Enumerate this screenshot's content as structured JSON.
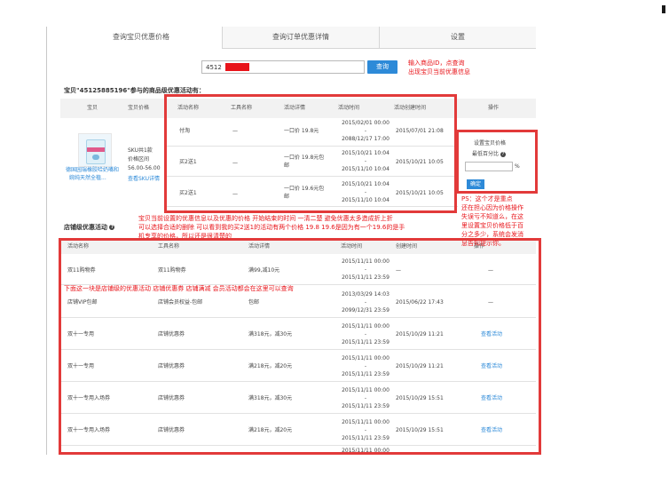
{
  "tabs": [
    "查询宝贝优惠价格",
    "查询订单优惠详情",
    "设置"
  ],
  "search": {
    "value": "4512",
    "button": "查询"
  },
  "annotations": {
    "search_hint": [
      "输入商品ID，点查询",
      "出现宝贝当前优惠信息"
    ],
    "ps_note": [
      "PS：这个才是重点",
      "还在担心因为价格操作",
      "失误亏不知道么，在这",
      "里设置宝贝价格低于百",
      "分之多少，系统会发消",
      "息告知提示你。"
    ],
    "shop_note": [
      "宝贝当前设置的优惠信息以及优惠的价格 开始结束的时间 一清二楚 避免优惠太多造成折上折",
      "可以选择合适的删除 可以看到我的买2送1的活动有两个价格 19.8  19.6是因为有一个19.6的是手",
      "机专享的价格，所以还是很清楚的"
    ],
    "below_note": "下面这一块是店铺级的优惠活动 店铺优惠券  店铺满减 会员活动都会在这里可以查询"
  },
  "item_heading": "宝贝\"45125885196\"参与的商品级优惠活动有：",
  "item_table": {
    "headers": [
      "宝贝",
      "宝贝价格",
      "活动名称",
      "工具名称",
      "活动详情",
      "活动时间",
      "活动创建时间",
      "操作"
    ],
    "product": {
      "name_lines": [
        "德国园瑞橡胶哈奶嘴和",
        "婉纯天然全植..."
      ],
      "price_lines": [
        "SKU共1款",
        "价格区间",
        "56.00-56.00"
      ],
      "sku_link": "查看SKU详情"
    },
    "rows": [
      {
        "name": "付淘",
        "tool": "—",
        "detail": [
          "一口价 19.8元"
        ],
        "time": [
          "2015/02/01 00:00",
          "-",
          "2088/12/17 17:00"
        ],
        "created": "2015/07/01 21:08"
      },
      {
        "name": "买2送1",
        "tool": "—",
        "detail": [
          "一口价 19.8元包",
          "邮"
        ],
        "time": [
          "2015/10/21 10:04",
          "-",
          "2015/11/10 10:04"
        ],
        "created": "2015/10/21 10:05"
      },
      {
        "name": "买2送1",
        "tool": "—",
        "detail": [
          "一口价 19.6元包",
          "邮"
        ],
        "time": [
          "2015/10/21 10:04",
          "-",
          "2015/11/10 10:04"
        ],
        "created": "2015/10/21 10:05"
      }
    ],
    "settings": {
      "title": "设置宝贝价格",
      "label": "最低百分比",
      "help": "?",
      "unit": "%",
      "confirm": "确定"
    }
  },
  "shop_heading": "店铺级优惠活动",
  "shop_table": {
    "headers": [
      "活动名称",
      "工具名称",
      "活动详情",
      "活动时间",
      "创建时间",
      "操作"
    ],
    "rows": [
      {
        "name": "双11购物券",
        "tool": "双11购物券",
        "detail": "满99,减10元",
        "time": [
          "2015/11/11 00:00",
          "-",
          "2015/11/11 23:59"
        ],
        "created": "—",
        "op": "—"
      },
      {
        "name": "店铺VIP包邮",
        "tool": "店铺会员权益-包邮",
        "detail": "包邮",
        "time": [
          "2013/03/29 14:03",
          "-",
          "2099/12/31 23:59"
        ],
        "created": "2015/06/22 17:43",
        "op": "—"
      },
      {
        "name": "双十一专用",
        "tool": "店铺优惠券",
        "detail": "满318元，减30元",
        "time": [
          "2015/11/11 00:00",
          "-",
          "2015/11/11 23:59"
        ],
        "created": "2015/10/29 11:21",
        "op": "查看活动"
      },
      {
        "name": "双十一专用",
        "tool": "店铺优惠券",
        "detail": "满218元，减20元",
        "time": [
          "2015/11/11 00:00",
          "-",
          "2015/11/11 23:59"
        ],
        "created": "2015/10/29 11:21",
        "op": "查看活动"
      },
      {
        "name": "双十一专用入场券",
        "tool": "店铺优惠券",
        "detail": "满318元，减30元",
        "time": [
          "2015/11/11 00:00",
          "-",
          "2015/11/11 23:59"
        ],
        "created": "2015/10/29 15:51",
        "op": "查看活动"
      },
      {
        "name": "双十一专用入场券",
        "tool": "店铺优惠券",
        "detail": "满218元，减20元",
        "time": [
          "2015/11/11 00:00",
          "-",
          "2015/11/11 23:59"
        ],
        "created": "2015/10/29 15:51",
        "op": "查看活动"
      }
    ],
    "partial_row": [
      "2015/11/11 00:00"
    ]
  },
  "colors": {
    "accent": "#2d8ad8",
    "annotation_red": "#e8141a",
    "box_red": "#e23a3a"
  }
}
